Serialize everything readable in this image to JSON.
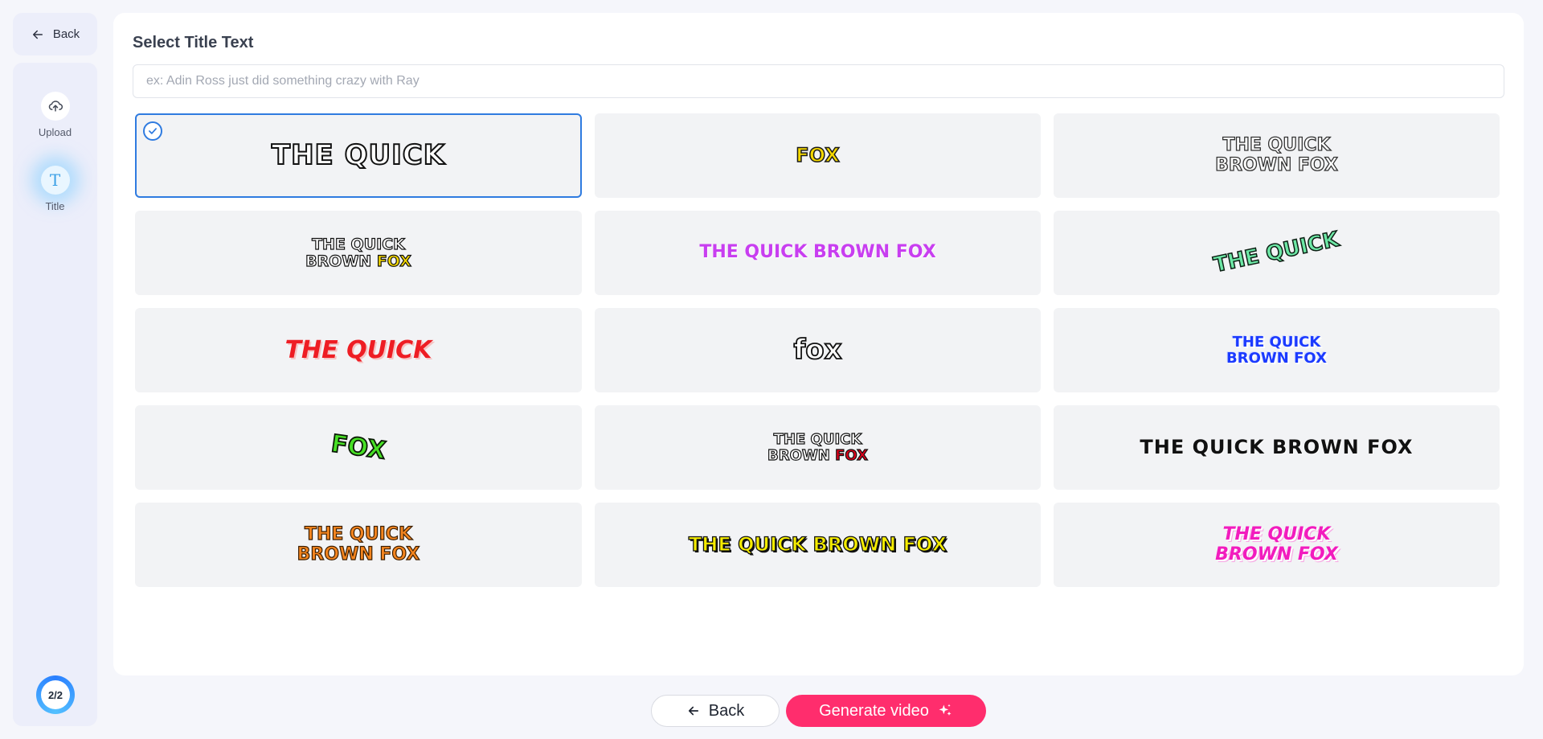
{
  "nav": {
    "back_label": "Back"
  },
  "sidebar": {
    "items": [
      {
        "label": "Upload",
        "icon": "cloud-upload-icon"
      },
      {
        "label": "Title",
        "icon": "text-t-icon"
      }
    ],
    "step_indicator": "2/2"
  },
  "main": {
    "heading": "Select Title Text",
    "title_input": {
      "placeholder": "ex: Adin Ross just did something crazy with Ray",
      "value": ""
    },
    "selected_style_index": 0,
    "styles": [
      {
        "text": "THE QUICK"
      },
      {
        "text": "FOX"
      },
      {
        "text": "THE QUICK\nBROWN FOX"
      },
      {
        "text_main": "THE QUICK\nBROWN ",
        "text_highlight": "FOX"
      },
      {
        "text": "THE QUICK BROWN FOX"
      },
      {
        "text": "THE QUICK"
      },
      {
        "text": "THE QUICK"
      },
      {
        "text": "fox"
      },
      {
        "text": "THE QUICK\nBROWN FOX"
      },
      {
        "text": "FOX"
      },
      {
        "text_main": "THE QUICK\nBROWN ",
        "text_highlight": "FOX"
      },
      {
        "text": "THE QUICK BROWN FOX"
      },
      {
        "text": "THE QUICK\nBROWN FOX"
      },
      {
        "text": "THE QUICK BROWN FOX"
      },
      {
        "text": "THE QUICK\nBROWN FOX"
      }
    ]
  },
  "footer": {
    "back_label": "Back",
    "generate_label": "Generate video"
  },
  "colors": {
    "accent": "#ff2d6d",
    "selection": "#2f7be0"
  }
}
